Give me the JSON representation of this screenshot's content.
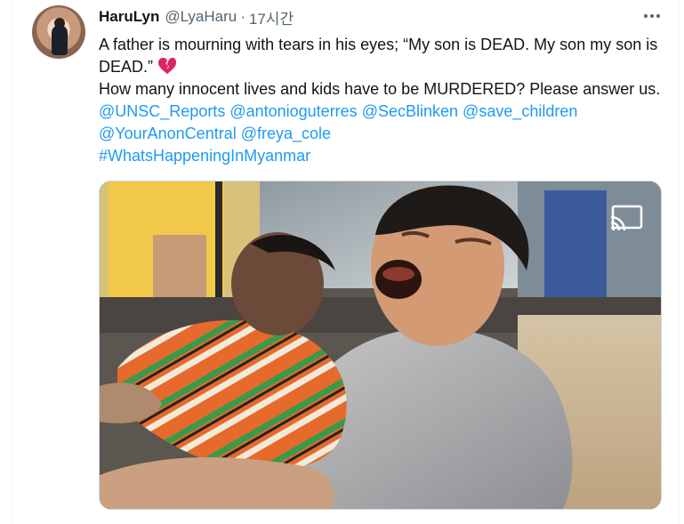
{
  "tweet": {
    "display_name": "HaruLyn",
    "handle": "@LyaHaru",
    "separator": "·",
    "time": "17시간",
    "line1": "A father is mourning with tears in his eyes; “My son is DEAD. My son my son is DEAD.”",
    "line2_text": "How many innocent lives and kids have to be MURDERED? Please answer us.",
    "mentions": [
      "@UNSC_Reports",
      "@antonioguterres",
      "@SecBlinken",
      "@save_children",
      "@YourAnonCentral",
      "@freya_cole"
    ],
    "hashtag": "#WhatsHappeningInMyanmar"
  },
  "colors": {
    "link": "#1d9bf0",
    "text": "#0f1419",
    "muted": "#536471",
    "broken_heart": "#e0245e"
  },
  "icons": {
    "more": "more-horizontal-icon",
    "emoji": "broken-heart-icon",
    "cast": "cast-icon"
  }
}
